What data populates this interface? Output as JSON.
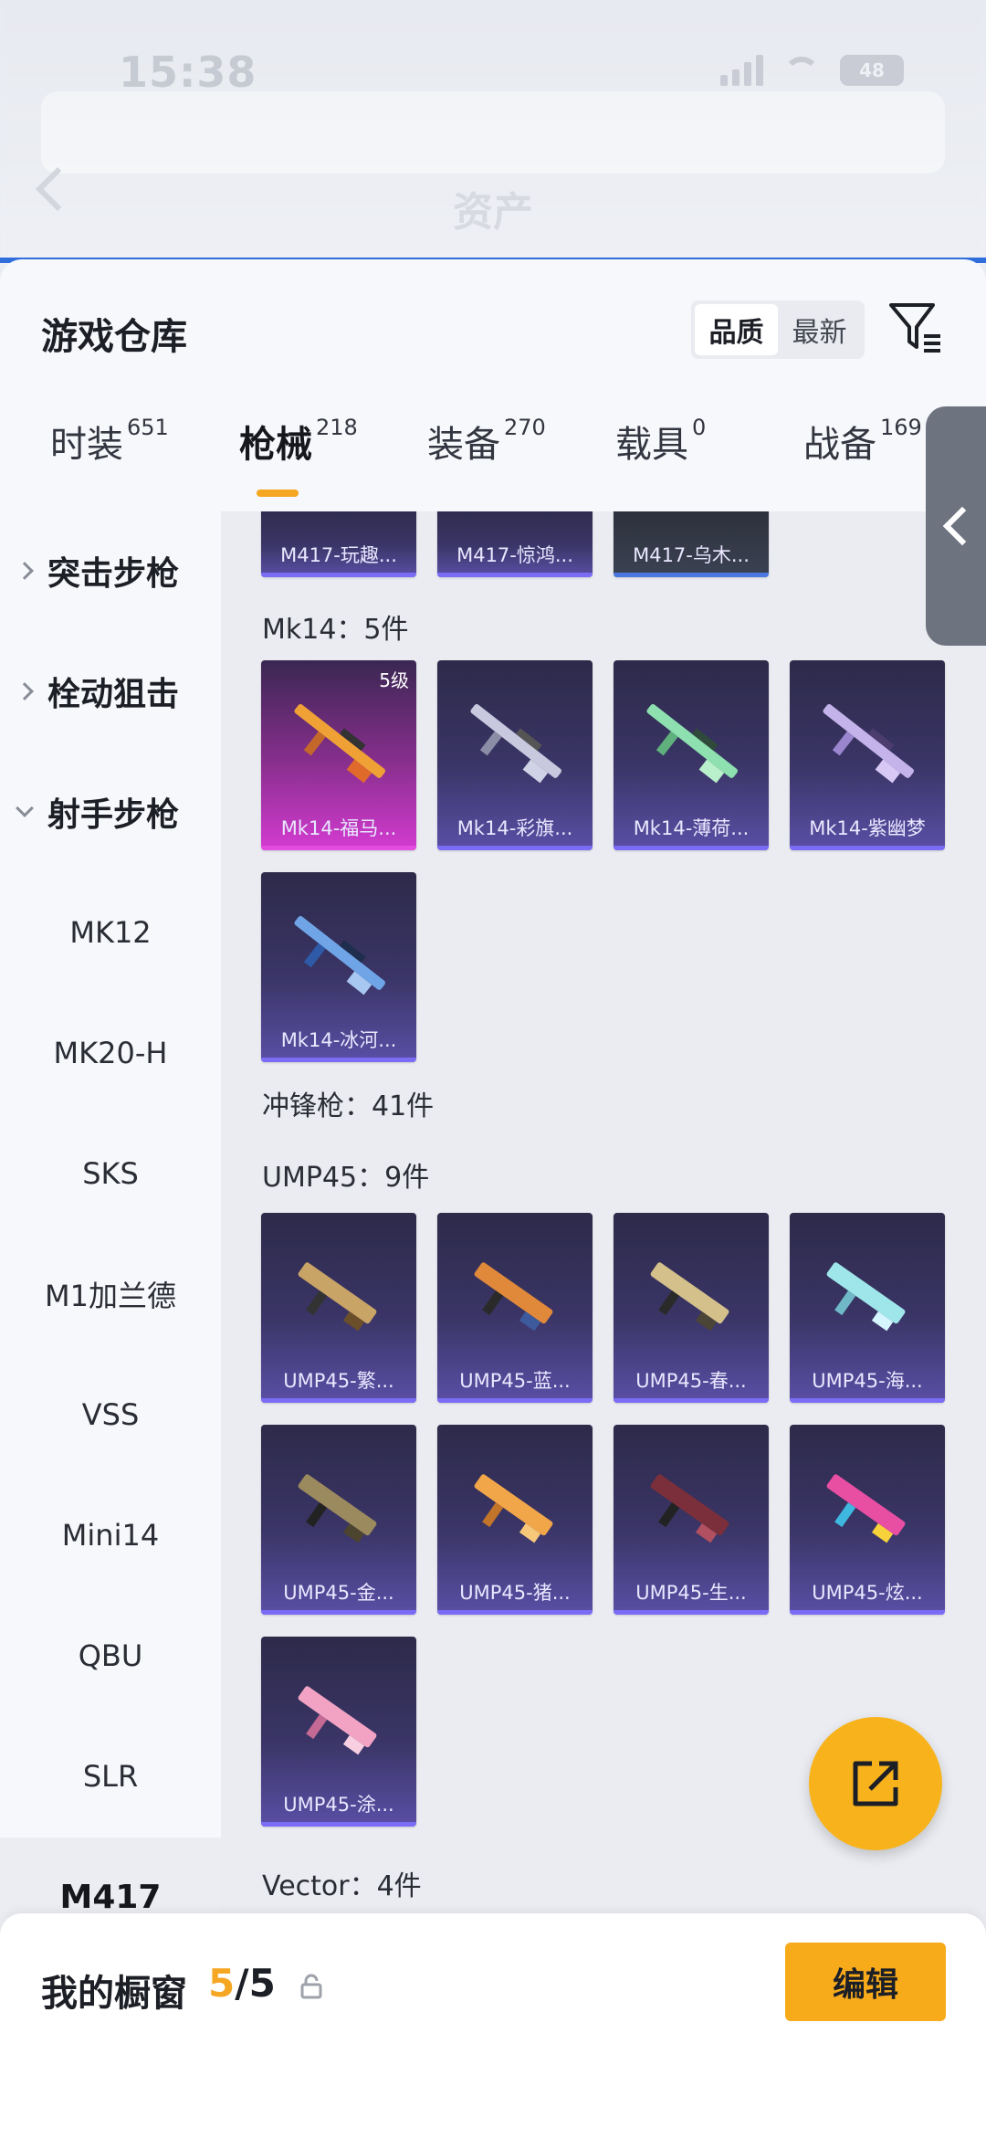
{
  "status_bar": {
    "time": "15:38",
    "battery": "48"
  },
  "header": {
    "title": "资产"
  },
  "sheet": {
    "title": "游戏仓库",
    "sort_options": [
      "品质",
      "最新"
    ],
    "active_sort": "品质"
  },
  "tabs": [
    {
      "label": "时装",
      "count": "651"
    },
    {
      "label": "枪械",
      "count": "218"
    },
    {
      "label": "装备",
      "count": "270"
    },
    {
      "label": "载具",
      "count": "0"
    },
    {
      "label": "战备",
      "count": "169"
    }
  ],
  "sidebar": {
    "categories": [
      "突击步枪",
      "栓动狙击",
      "射手步枪"
    ],
    "subitems": [
      "MK12",
      "MK20-H",
      "SKS",
      "M1加兰德",
      "VSS",
      "Mini14",
      "QBU",
      "SLR",
      "M417"
    ],
    "active": "M417"
  },
  "content": {
    "top_partial_cards": [
      "M417-玩趣...",
      "M417-惊鸿...",
      "M417-乌木..."
    ],
    "groups": [
      {
        "label": "Mk14：5件",
        "cards": [
          {
            "name": "Mk14-福马...",
            "level": "5级"
          },
          {
            "name": "Mk14-彩旗..."
          },
          {
            "name": "Mk14-薄荷..."
          },
          {
            "name": "Mk14-紫幽梦"
          },
          {
            "name": "Mk14-冰河..."
          }
        ]
      },
      {
        "label": "冲锋枪：41件",
        "cards": []
      },
      {
        "label": "UMP45：9件",
        "cards": [
          {
            "name": "UMP45-繁..."
          },
          {
            "name": "UMP45-蓝..."
          },
          {
            "name": "UMP45-春..."
          },
          {
            "name": "UMP45-海..."
          },
          {
            "name": "UMP45-金..."
          },
          {
            "name": "UMP45-猪..."
          },
          {
            "name": "UMP45-生..."
          },
          {
            "name": "UMP45-炫..."
          },
          {
            "name": "UMP45-涂..."
          }
        ]
      },
      {
        "label": "Vector：4件",
        "cards": []
      }
    ]
  },
  "bottom": {
    "showcase_label": "我的橱窗",
    "showcase_current": "5",
    "showcase_total": "/5",
    "edit_label": "编辑"
  },
  "colors": {
    "accent": "#f5a623",
    "card_blue": "#3a3566",
    "card_purple": "#d43bd1"
  }
}
